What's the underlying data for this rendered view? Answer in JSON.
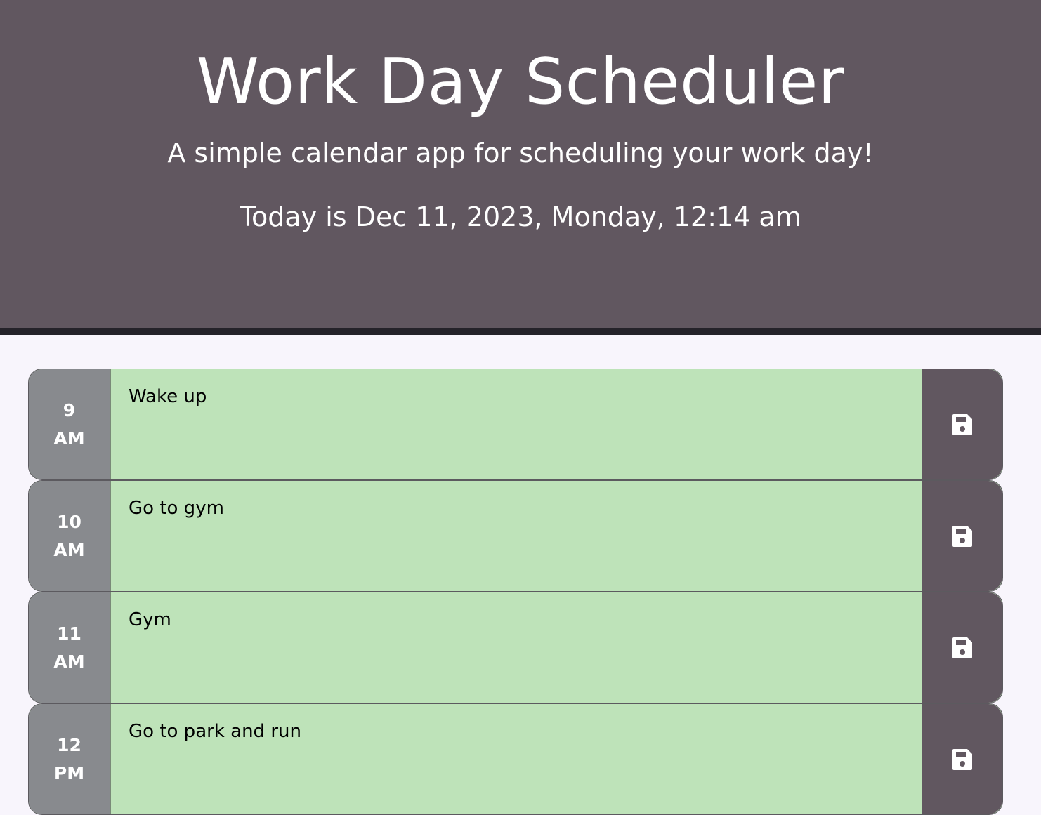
{
  "header": {
    "title": "Work Day Scheduler",
    "subtitle": "A simple calendar app for scheduling your work day!",
    "current_day": "Today is Dec 11, 2023, Monday, 12:14 am"
  },
  "colors": {
    "header_bg": "#615760",
    "header_border": "#25232a",
    "page_bg": "#f8f5fc",
    "hour_bg": "#888a8e",
    "future_row_bg": "#bee3b9",
    "save_button_bg": "#615760"
  },
  "time_blocks": [
    {
      "hour": "9",
      "period": "AM",
      "description": "Wake up",
      "save_icon": "floppy-disk-icon"
    },
    {
      "hour": "10",
      "period": "AM",
      "description": "Go to gym",
      "save_icon": "floppy-disk-icon"
    },
    {
      "hour": "11",
      "period": "AM",
      "description": "Gym",
      "save_icon": "floppy-disk-icon"
    },
    {
      "hour": "12",
      "period": "PM",
      "description": "Go to park and run",
      "save_icon": "floppy-disk-icon"
    }
  ]
}
